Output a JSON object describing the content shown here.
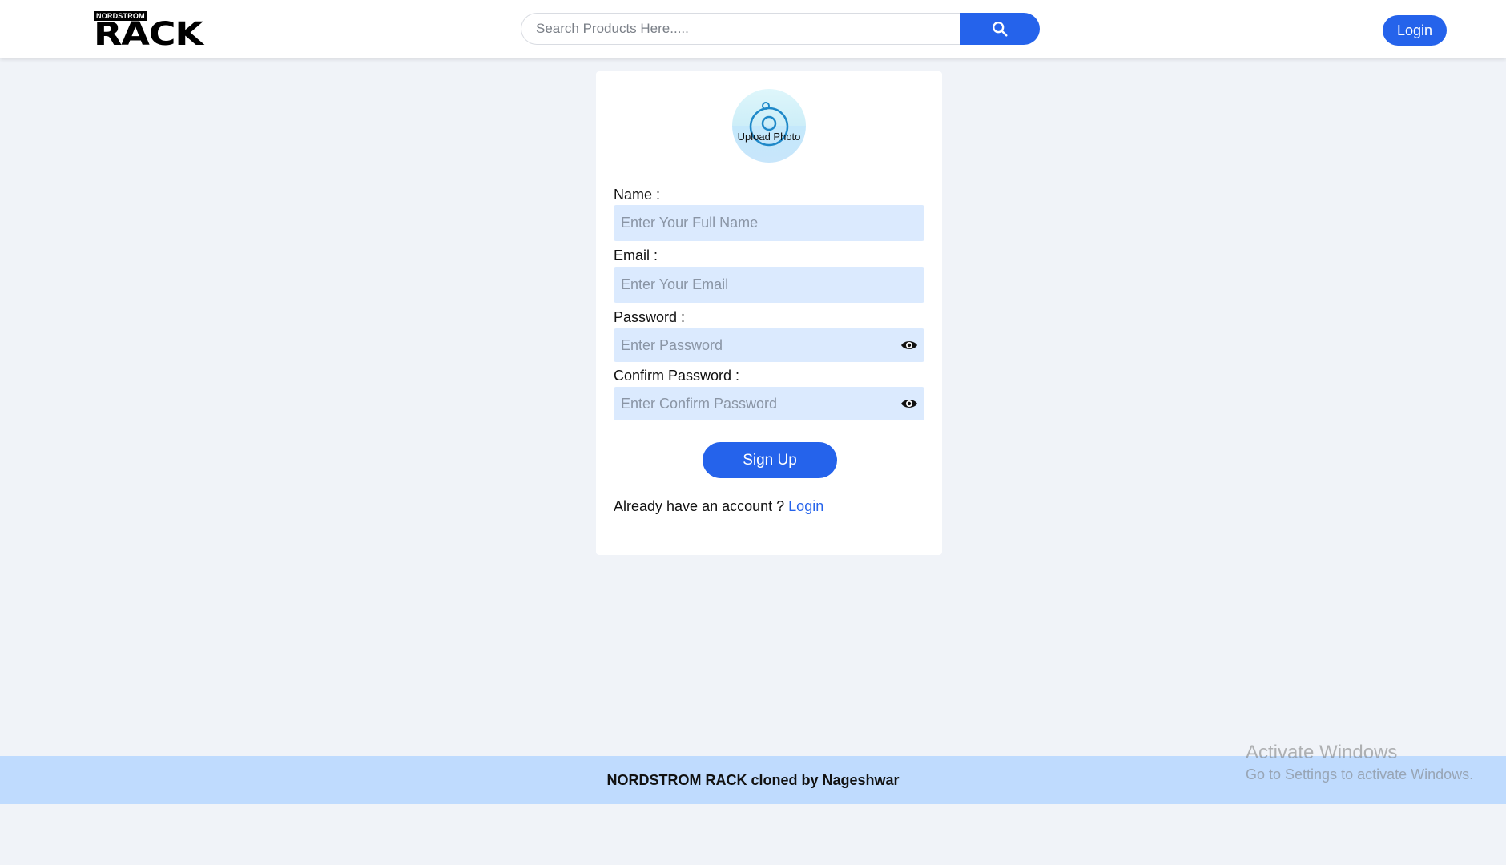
{
  "header": {
    "logo": {
      "top_text": "NORDSTROM",
      "main_text": "RACK"
    },
    "search": {
      "placeholder": "Search Products Here....."
    },
    "login_label": "Login"
  },
  "signup_form": {
    "upload_photo_label": "Upload Photo",
    "fields": {
      "name": {
        "label": "Name :",
        "placeholder": "Enter Your Full Name",
        "value": ""
      },
      "email": {
        "label": "Email :",
        "placeholder": "Enter Your Email",
        "value": ""
      },
      "password": {
        "label": "Password :",
        "placeholder": "Enter Password",
        "value": ""
      },
      "confirm_password": {
        "label": "Confirm Password :",
        "placeholder": "Enter Confirm Password",
        "value": ""
      }
    },
    "submit_label": "Sign Up",
    "account_prompt": "Already have an account ?",
    "login_link_label": "Login"
  },
  "footer": {
    "text": "NORDSTROM RACK cloned by Nageshwar"
  },
  "windows_watermark": {
    "title": "Activate Windows",
    "subtitle": "Go to Settings to activate Windows."
  },
  "colors": {
    "accent": "#2563eb",
    "input_background": "#dbeafe",
    "footer_background": "#bfdbfe",
    "page_background": "#f0f3f8"
  },
  "icons": {
    "search": "search-icon",
    "eye": "eye-icon",
    "camera": "camera-icon"
  }
}
